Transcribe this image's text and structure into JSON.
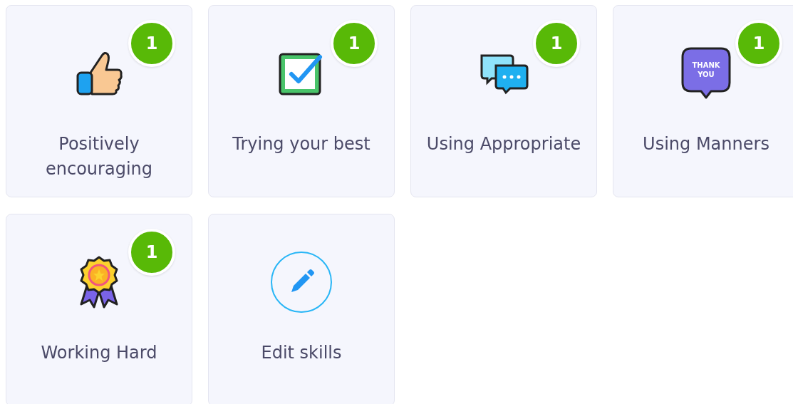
{
  "skills": [
    {
      "kind": "skill",
      "label": "Positively encouraging",
      "count": "1"
    },
    {
      "kind": "skill",
      "label": "Trying your best",
      "count": "1"
    },
    {
      "kind": "skill",
      "label": "Using Appropriate",
      "count": "1"
    },
    {
      "kind": "skill",
      "label": "Using Manners",
      "count": "1",
      "icon_text": "THANK YOU"
    },
    {
      "kind": "skill",
      "label": "Working Hard",
      "count": "1"
    },
    {
      "kind": "edit",
      "label": "Edit skills"
    }
  ]
}
